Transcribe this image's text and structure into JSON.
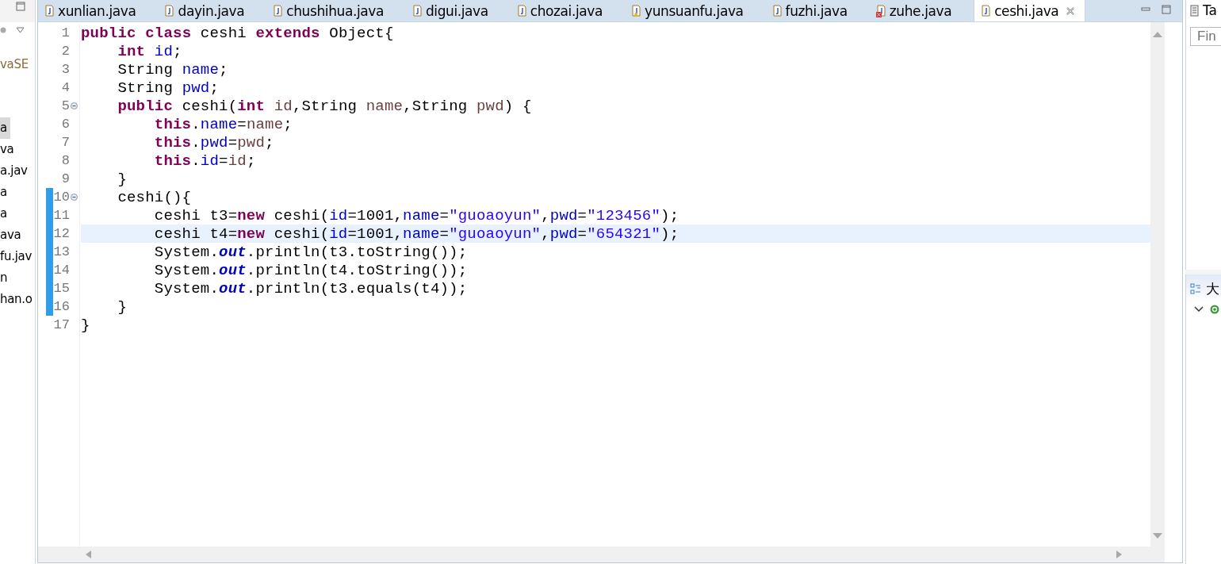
{
  "left_panel": {
    "items": [
      {
        "label": "vaSE",
        "selected": false
      },
      {
        "label": "a",
        "selected": true
      },
      {
        "label": "va",
        "selected": false
      },
      {
        "label": "a.jav",
        "selected": false
      },
      {
        "label": "a",
        "selected": false
      },
      {
        "label": "a",
        "selected": false
      },
      {
        "label": "ava",
        "selected": false
      },
      {
        "label": "fu.jav",
        "selected": false
      },
      {
        "label": "n",
        "selected": false
      },
      {
        "label": "han.o",
        "selected": false
      }
    ]
  },
  "editor": {
    "tabs": [
      {
        "label": "xunlian.java",
        "selected": false,
        "kind": "plain"
      },
      {
        "label": "dayin.java",
        "selected": false,
        "kind": "plain"
      },
      {
        "label": "chushihua.java",
        "selected": false,
        "kind": "plain"
      },
      {
        "label": "digui.java",
        "selected": false,
        "kind": "plain"
      },
      {
        "label": "chozai.java",
        "selected": false,
        "kind": "plain"
      },
      {
        "label": "yunsuanfu.java",
        "selected": false,
        "kind": "warning"
      },
      {
        "label": "fuzhi.java",
        "selected": false,
        "kind": "plain"
      },
      {
        "label": "zuhe.java",
        "selected": false,
        "kind": "error"
      },
      {
        "label": "ceshi.java",
        "selected": true,
        "kind": "plain"
      }
    ],
    "lines": [
      {
        "number": "1",
        "fold": false,
        "changed": false,
        "current": false,
        "segments": [
          {
            "kind": "keyword",
            "text": "public "
          },
          {
            "kind": "keyword",
            "text": "class"
          },
          {
            "kind": "plain",
            "text": " ceshi "
          },
          {
            "kind": "keyword",
            "text": "extends"
          },
          {
            "kind": "plain",
            "text": " Object{"
          }
        ]
      },
      {
        "number": "2",
        "fold": false,
        "changed": false,
        "current": false,
        "segments": [
          {
            "kind": "keyword",
            "text": "    int "
          },
          {
            "kind": "field",
            "text": "id"
          },
          {
            "kind": "plain",
            "text": ";"
          }
        ]
      },
      {
        "number": "3",
        "fold": false,
        "changed": false,
        "current": false,
        "segments": [
          {
            "kind": "plain",
            "text": "    String "
          },
          {
            "kind": "field",
            "text": "name"
          },
          {
            "kind": "plain",
            "text": ";"
          }
        ]
      },
      {
        "number": "4",
        "fold": false,
        "changed": false,
        "current": false,
        "segments": [
          {
            "kind": "plain",
            "text": "    String "
          },
          {
            "kind": "field",
            "text": "pwd"
          },
          {
            "kind": "plain",
            "text": ";"
          }
        ]
      },
      {
        "number": "5",
        "fold": true,
        "changed": false,
        "current": false,
        "segments": [
          {
            "kind": "keyword",
            "text": "    public"
          },
          {
            "kind": "plain",
            "text": " ceshi("
          },
          {
            "kind": "keyword",
            "text": "int "
          },
          {
            "kind": "param",
            "text": "id"
          },
          {
            "kind": "plain",
            "text": ",String "
          },
          {
            "kind": "param",
            "text": "name"
          },
          {
            "kind": "plain",
            "text": ",String "
          },
          {
            "kind": "param",
            "text": "pwd"
          },
          {
            "kind": "plain",
            "text": ") {"
          }
        ]
      },
      {
        "number": "6",
        "fold": false,
        "changed": false,
        "current": false,
        "segments": [
          {
            "kind": "keyword",
            "text": "        this"
          },
          {
            "kind": "plain",
            "text": "."
          },
          {
            "kind": "field",
            "text": "name"
          },
          {
            "kind": "plain",
            "text": "="
          },
          {
            "kind": "param",
            "text": "name"
          },
          {
            "kind": "plain",
            "text": ";"
          }
        ]
      },
      {
        "number": "7",
        "fold": false,
        "changed": false,
        "current": false,
        "segments": [
          {
            "kind": "keyword",
            "text": "        this"
          },
          {
            "kind": "plain",
            "text": "."
          },
          {
            "kind": "field",
            "text": "pwd"
          },
          {
            "kind": "plain",
            "text": "="
          },
          {
            "kind": "param",
            "text": "pwd"
          },
          {
            "kind": "plain",
            "text": ";"
          }
        ]
      },
      {
        "number": "8",
        "fold": false,
        "changed": false,
        "current": false,
        "segments": [
          {
            "kind": "keyword",
            "text": "        this"
          },
          {
            "kind": "plain",
            "text": "."
          },
          {
            "kind": "field",
            "text": "id"
          },
          {
            "kind": "plain",
            "text": "="
          },
          {
            "kind": "param",
            "text": "id"
          },
          {
            "kind": "plain",
            "text": ";"
          }
        ]
      },
      {
        "number": "9",
        "fold": false,
        "changed": false,
        "current": false,
        "segments": [
          {
            "kind": "plain",
            "text": "    }"
          }
        ]
      },
      {
        "number": "10",
        "fold": true,
        "changed": true,
        "current": false,
        "segments": [
          {
            "kind": "plain",
            "text": "    ceshi(){"
          }
        ]
      },
      {
        "number": "11",
        "fold": false,
        "changed": true,
        "current": false,
        "segments": [
          {
            "kind": "plain",
            "text": "        ceshi t3="
          },
          {
            "kind": "keyword",
            "text": "new"
          },
          {
            "kind": "plain",
            "text": " ceshi("
          },
          {
            "kind": "field",
            "text": "id"
          },
          {
            "kind": "plain",
            "text": "=1001,"
          },
          {
            "kind": "field",
            "text": "name"
          },
          {
            "kind": "plain",
            "text": "="
          },
          {
            "kind": "string",
            "text": "\"guoaoyun\""
          },
          {
            "kind": "plain",
            "text": ","
          },
          {
            "kind": "field",
            "text": "pwd"
          },
          {
            "kind": "plain",
            "text": "="
          },
          {
            "kind": "string",
            "text": "\"123456\""
          },
          {
            "kind": "plain",
            "text": ");"
          }
        ]
      },
      {
        "number": "12",
        "fold": false,
        "changed": true,
        "current": true,
        "segments": [
          {
            "kind": "plain",
            "text": "        ceshi t4="
          },
          {
            "kind": "keyword",
            "text": "new"
          },
          {
            "kind": "plain",
            "text": " ceshi("
          },
          {
            "kind": "field",
            "text": "id"
          },
          {
            "kind": "plain",
            "text": "=1001,"
          },
          {
            "kind": "field",
            "text": "name"
          },
          {
            "kind": "plain",
            "text": "="
          },
          {
            "kind": "string",
            "text": "\"guoaoyun\""
          },
          {
            "kind": "plain",
            "text": ","
          },
          {
            "kind": "field",
            "text": "pwd"
          },
          {
            "kind": "plain",
            "text": "="
          },
          {
            "kind": "string",
            "text": "\"654321\""
          },
          {
            "kind": "plain",
            "text": ");"
          }
        ]
      },
      {
        "number": "13",
        "fold": false,
        "changed": true,
        "current": false,
        "segments": [
          {
            "kind": "plain",
            "text": "        System."
          },
          {
            "kind": "static",
            "text": "out"
          },
          {
            "kind": "plain",
            "text": ".println(t3.toString());"
          }
        ]
      },
      {
        "number": "14",
        "fold": false,
        "changed": true,
        "current": false,
        "segments": [
          {
            "kind": "plain",
            "text": "        System."
          },
          {
            "kind": "static",
            "text": "out"
          },
          {
            "kind": "plain",
            "text": ".println(t4.toString());"
          }
        ]
      },
      {
        "number": "15",
        "fold": false,
        "changed": true,
        "current": false,
        "segments": [
          {
            "kind": "plain",
            "text": "        System."
          },
          {
            "kind": "static",
            "text": "out"
          },
          {
            "kind": "plain",
            "text": ".println(t3.equals(t4));"
          }
        ]
      },
      {
        "number": "16",
        "fold": false,
        "changed": true,
        "current": false,
        "segments": [
          {
            "kind": "plain",
            "text": "    }"
          }
        ]
      },
      {
        "number": "17",
        "fold": false,
        "changed": false,
        "current": false,
        "segments": [
          {
            "kind": "plain",
            "text": "}"
          }
        ]
      }
    ]
  },
  "right_panel": {
    "title": "Ta",
    "search": {
      "placeholder": "Fin"
    },
    "outline_title": "大"
  }
}
